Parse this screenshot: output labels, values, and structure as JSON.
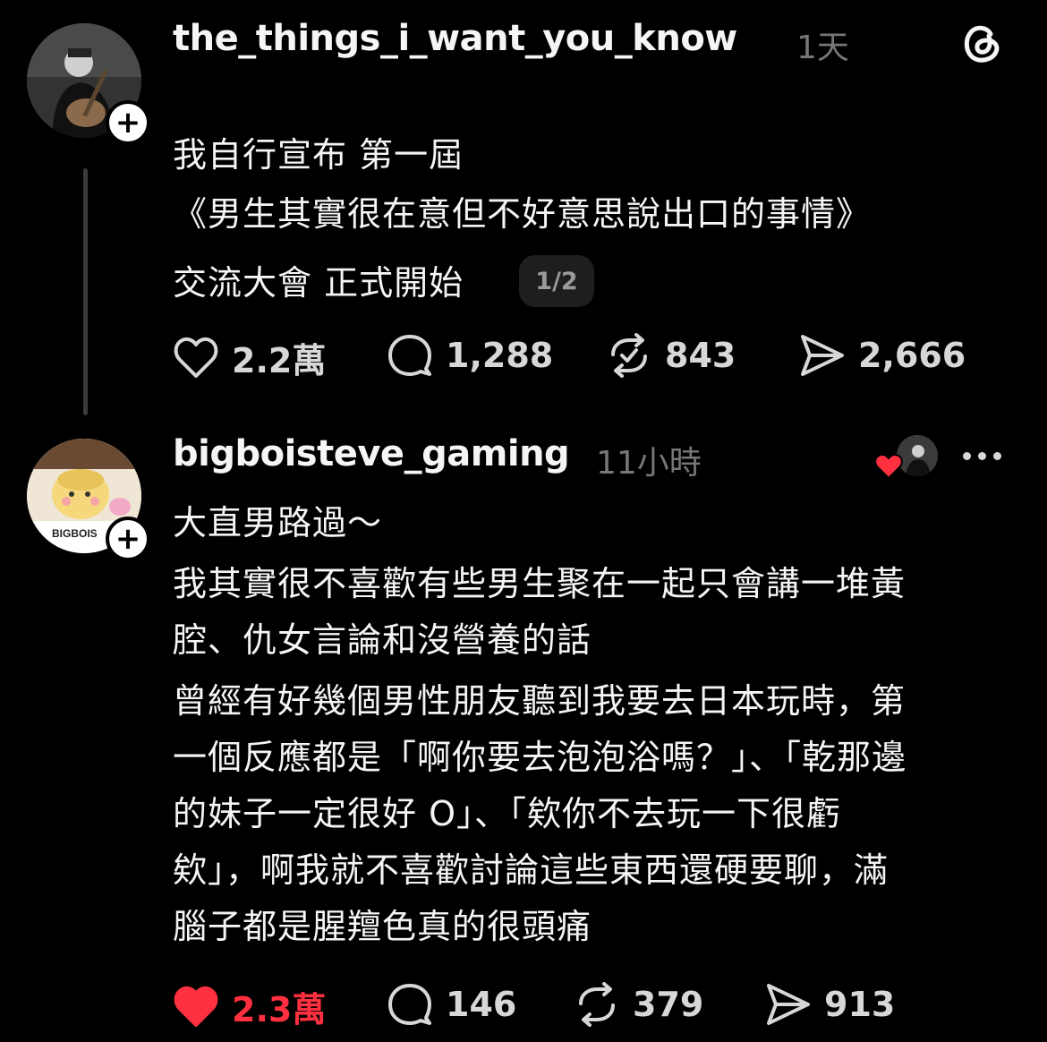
{
  "posts": [
    {
      "username": "the_things_i_want_you_know",
      "time": "1天",
      "lines": [
        "我自行宣布 第一屆",
        "《男生其實很在意但不好意思說出口的事情》",
        "交流大會 正式開始"
      ],
      "page_indicator": "1/2",
      "actions": {
        "likes": "2.2萬",
        "replies": "1,288",
        "reposts": "843",
        "shares": "2,666"
      }
    },
    {
      "username": "bigboisteve_gaming",
      "time": "11小時",
      "avatar_text": "BIGBOIS",
      "lines": [
        "大直男路過～",
        "我其實很不喜歡有些男生聚在一起只會講一堆黃",
        "腔、仇女言論和沒營養的話",
        "曾經有好幾個男性朋友聽到我要去日本玩時，第",
        "一個反應都是「啊你要去泡泡浴嗎？」、「乾那邊",
        "的妹子一定很好 O」、「欸你不去玩一下很虧",
        "欸」，啊我就不喜歡討論這些東西還硬要聊，滿",
        "腦子都是腥羶色真的很頭痛"
      ],
      "actions": {
        "likes": "2.3萬",
        "replies": "146",
        "reposts": "379",
        "shares": "913"
      }
    }
  ],
  "icons": {
    "app_logo": "threads-logo-icon",
    "follow": "plus-icon",
    "like": "heart-icon",
    "reply": "speech-bubble-icon",
    "repost": "repost-icon",
    "share": "send-icon",
    "more": "ellipsis-icon"
  },
  "colors": {
    "background": "#000000",
    "text": "#f3f5f7",
    "muted": "#777777",
    "like_active": "#ff3040"
  }
}
